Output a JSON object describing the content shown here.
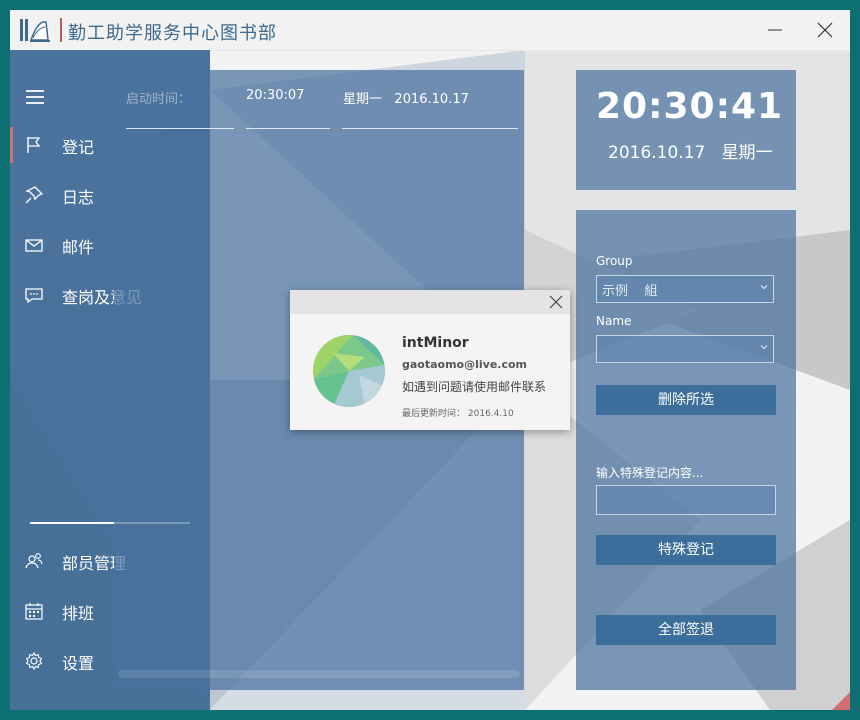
{
  "window": {
    "title": "勤工助学服务中心图书部",
    "minimize_glyph": "minimize-icon",
    "close_glyph": "close-icon"
  },
  "sidebar": {
    "items": [
      {
        "label": "登记",
        "icon": "flag-icon",
        "active": true
      },
      {
        "label": "日志",
        "icon": "pin-icon"
      },
      {
        "label": "邮件",
        "icon": "mail-icon"
      },
      {
        "label": "查岗及意见",
        "icon": "comment-icon"
      }
    ],
    "bottom_items": [
      {
        "label": "部员管理",
        "icon": "people-icon"
      },
      {
        "label": "排班",
        "icon": "calendar-icon"
      },
      {
        "label": "设置",
        "icon": "gear-icon"
      }
    ]
  },
  "main": {
    "start_label": "启动时间：",
    "start_time": "20:30:07",
    "start_weekday": "星期一",
    "start_date": "2016.10.17"
  },
  "clock": {
    "time": "20:30:41",
    "date": "2016.10.17",
    "weekday": "星期一"
  },
  "form": {
    "group_label": "Group",
    "group_value": "示例    組",
    "name_label": "Name",
    "name_value": "",
    "delete_button": "删除所选",
    "special_label": "输入特殊登记内容...",
    "special_value": "",
    "special_button": "特殊登记",
    "signout_button": "全部签退"
  },
  "dialog": {
    "name": "intMinor",
    "email": "gaotaomo@live.com",
    "message": "如遇到问题请使用邮件联系",
    "updated_label": "最后更新时间：",
    "updated_date": "2016.4.10"
  },
  "colors": {
    "frame": "#0e6f72",
    "panel": "#4a72a0",
    "button": "#3b6e9b",
    "accent": "#d27070",
    "title_text": "#3d6a8d"
  }
}
